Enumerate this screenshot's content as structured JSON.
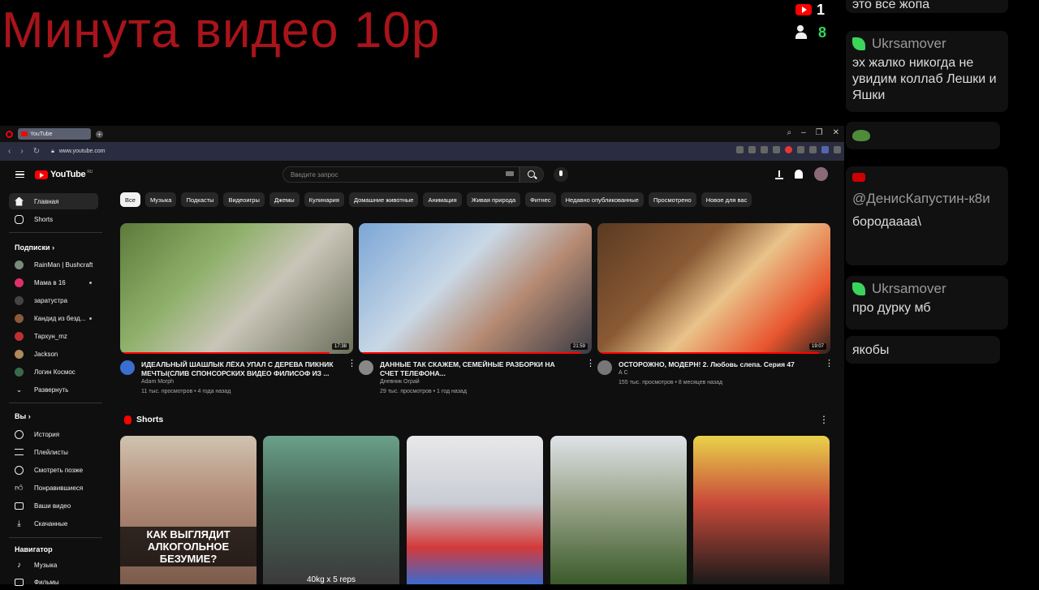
{
  "stream": {
    "title": "Минута видео 10р",
    "yt_count": "1",
    "viewer_count": "8"
  },
  "chat": [
    {
      "user": "",
      "text": "это все жопа",
      "badge": ""
    },
    {
      "user": "Ukrsamover",
      "text": "эх жалко никогда не увидим коллаб Лешки и Яшки",
      "badge": "leaf"
    },
    {
      "user": "",
      "text": "",
      "badge": "frog"
    },
    {
      "user": "@ДенисКапустин-к8и",
      "text": "бородаааа\\",
      "badge": "youtube"
    },
    {
      "user": "Ukrsamover",
      "text": "про дурку мб",
      "badge": "leaf"
    },
    {
      "user": "",
      "text": "якобы",
      "badge": ""
    }
  ],
  "browser": {
    "tab_title": "YouTube",
    "url": "www.youtube.com"
  },
  "youtube": {
    "logo": "YouTube",
    "region": "RU",
    "search_placeholder": "Введите запрос",
    "sidebar": {
      "main": [
        {
          "label": "Главная",
          "icon": "home-icon"
        },
        {
          "label": "Shorts",
          "icon": "shorts-icon"
        }
      ],
      "subscriptions_header": "Подписки",
      "subscriptions": [
        {
          "label": "RainMan | Bushcraft",
          "color": "#7a8a7a",
          "new": false
        },
        {
          "label": "Мама в 16",
          "color": "#e0306a",
          "new": true
        },
        {
          "label": "заратустра",
          "color": "#444444",
          "new": false
        },
        {
          "label": "Кандид из безд...",
          "color": "#8a5a3a",
          "new": true
        },
        {
          "label": "Тархун_mz",
          "color": "#c03030",
          "new": false
        },
        {
          "label": "Jackson",
          "color": "#b08a5a",
          "new": false
        },
        {
          "label": "Логин Космос",
          "color": "#3a6a4a",
          "new": false
        },
        {
          "label": "Развернуть",
          "color": "",
          "new": false
        }
      ],
      "you_header": "Вы",
      "you": [
        {
          "label": "История",
          "icon": "history-icon"
        },
        {
          "label": "Плейлисты",
          "icon": "playlist-icon"
        },
        {
          "label": "Смотреть позже",
          "icon": "clock-icon"
        },
        {
          "label": "Понравившиеся",
          "icon": "thumb-up-icon"
        },
        {
          "label": "Ваши видео",
          "icon": "video-icon"
        },
        {
          "label": "Скачанные",
          "icon": "download-icon"
        }
      ],
      "nav_header": "Навигатор",
      "nav": [
        {
          "label": "Музыка",
          "icon": "music-icon"
        },
        {
          "label": "Фильмы",
          "icon": "film-icon"
        }
      ]
    },
    "chips": [
      "Все",
      "Музыка",
      "Подкасты",
      "Видеоигры",
      "Джемы",
      "Кулинария",
      "Домашние животные",
      "Анимация",
      "Живая природа",
      "Фитнес",
      "Недавно опубликованные",
      "Просмотрено",
      "Новое для вас"
    ],
    "videos": [
      {
        "title": "ИДЕАЛЬНЫЙ ШАШЛЫК  ЛЁХА УПАЛ С ДЕРЕВА  ПИКНИК МЕЧТЫ(СЛИВ СПОНСОРСКИХ ВИДЕО ФИЛИСОФ ИЗ ...",
        "channel": "Adam Morph",
        "meta": "11 тыс. просмотров • 4 года назад",
        "duration": "17:38",
        "progress": 0.9
      },
      {
        "title": "ДАННЫЕ ТАК СКАЖЕМ, СЕМЕЙНЫЕ РАЗБОРКИ НА СЧЕТ ТЕЛЕФОНА...",
        "channel": "Дневник Ограй",
        "meta": "29 тыс. просмотров • 1 год назад",
        "duration": "21:59",
        "progress": 0.95
      },
      {
        "title": "ОСТОРОЖНО, МОДЕРН! 2.  Любовь слепа. Серия 47",
        "channel": "А С",
        "meta": "155 тыс. просмотров • 8 месяцев назад",
        "duration": "19:07",
        "progress": 0.95
      }
    ],
    "shorts_title": "Shorts",
    "shorts": [
      {
        "caption": "КАК ВЫГЛЯДИТ АЛКОГОЛЬНОЕ БЕЗУМИЕ?",
        "subcap": ""
      },
      {
        "caption": "",
        "subcap": "40kg x 5 reps"
      },
      {
        "caption": "",
        "subcap": ""
      },
      {
        "caption": "",
        "subcap": ""
      },
      {
        "caption": "",
        "subcap": ""
      }
    ]
  }
}
